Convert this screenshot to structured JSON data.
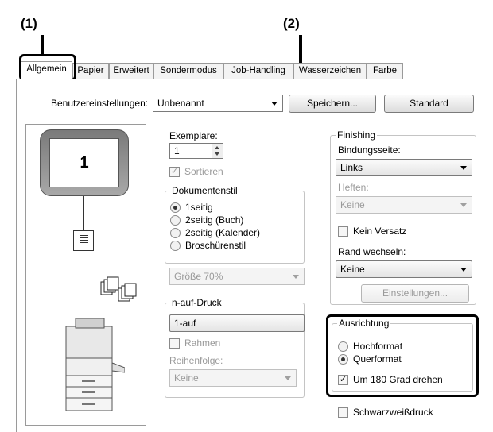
{
  "callouts": {
    "c1": "(1)",
    "c2": "(2)"
  },
  "tabs": [
    "Allgemein",
    "Papier",
    "Erweitert",
    "Sondermodus",
    "Job-Handling",
    "Wasserzeichen",
    "Farbe"
  ],
  "presets": {
    "label": "Benutzereinstellungen:",
    "value": "Unbenannt",
    "save_label": "Speichern...",
    "default_label": "Standard"
  },
  "preview": {
    "page_number": "1"
  },
  "copies": {
    "label": "Exemplare:",
    "value": "1",
    "collate_label": "Sortieren"
  },
  "document_style": {
    "legend": "Dokumentenstil",
    "options": [
      "1seitig",
      "2seitig (Buch)",
      "2seitig (Kalender)",
      "Broschürenstil"
    ],
    "selected": "1seitig",
    "size_value": "Größe 70%"
  },
  "nup": {
    "legend": "n-auf-Druck",
    "value": "1-auf",
    "border_label": "Rahmen",
    "order_label": "Reihenfolge:",
    "order_value": "Keine"
  },
  "finishing": {
    "legend": "Finishing",
    "binding_label": "Bindungsseite:",
    "binding_value": "Links",
    "staple_label": "Heften:",
    "staple_value": "Keine",
    "no_offset_label": "Kein Versatz",
    "margin_label": "Rand wechseln:",
    "margin_value": "Keine",
    "settings_label": "Einstellungen..."
  },
  "orientation": {
    "legend": "Ausrichtung",
    "portrait_label": "Hochformat",
    "landscape_label": "Querformat",
    "selected": "Querformat",
    "rotate_label": "Um 180 Grad drehen",
    "rotate_checked": true
  },
  "bw_print_label": "Schwarzweißdruck",
  "colors": {
    "highlight": "#000000",
    "border": "#9a9a9a",
    "disabled": "#9a9a9a"
  }
}
